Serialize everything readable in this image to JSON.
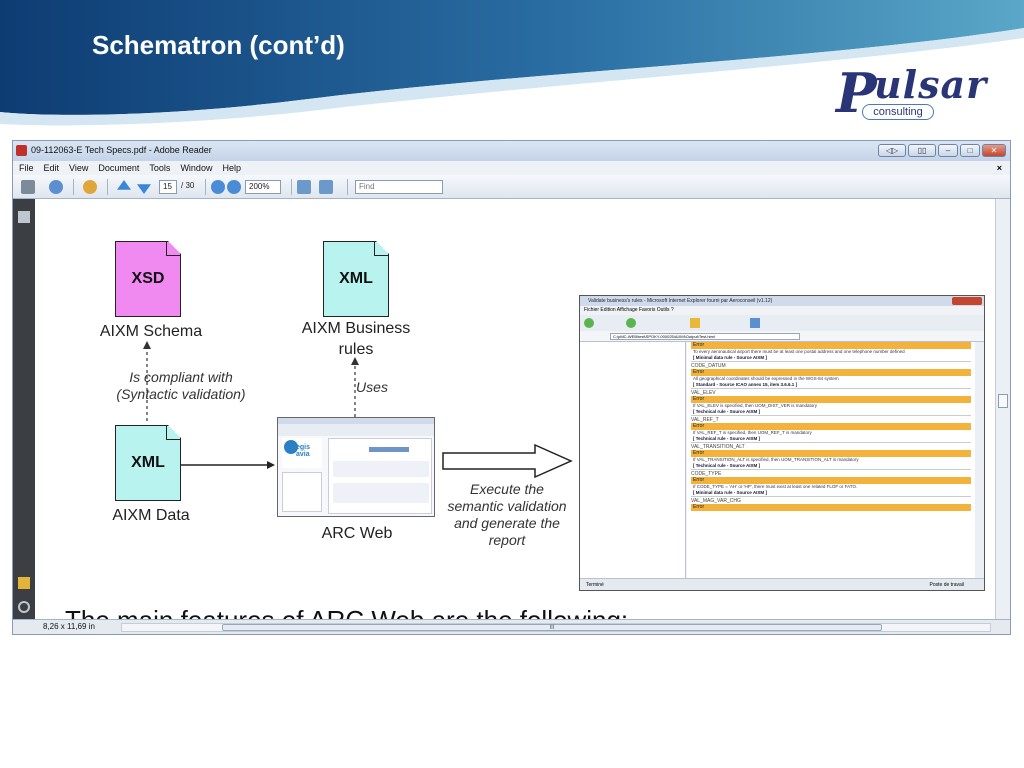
{
  "slide": {
    "title": "Schematron (cont’d)",
    "logo_text": "ulsar",
    "logo_initial": "P",
    "logo_sub": "consulting",
    "colors": {
      "header_dark": "#0d3c73",
      "header_light": "#5aa7c8",
      "logo": "#2a3578"
    }
  },
  "reader": {
    "window_title": "09-112063-E Tech Specs.pdf - Adobe Reader",
    "menu": [
      "File",
      "Edit",
      "View",
      "Document",
      "Tools",
      "Window",
      "Help"
    ],
    "menu_close": "×",
    "page_current": "15",
    "page_total": "/ 30",
    "zoom": "200%",
    "find_placeholder": "Find",
    "page_size": "8,26 x 11,69 in",
    "scroll_grip": "III",
    "bottom_cutoff_text": "The main features of ARC Web are the following:"
  },
  "diagram": {
    "xsd_label": "XSD",
    "xsd_caption": "AIXM Schema",
    "xml_rules_label": "XML",
    "xml_rules_caption_1": "AIXM Business",
    "xml_rules_caption_2": "rules",
    "xml_data_label": "XML",
    "xml_data_caption": "AIXM Data",
    "compliant_1": "Is compliant with",
    "compliant_2": "(Syntactic validation)",
    "uses": "Uses",
    "arc_web": "ARC Web",
    "execute_1": "Execute the",
    "execute_2": "semantic validation",
    "execute_3": "and generate the",
    "execute_4": "report",
    "mini_logo": "egis avia"
  },
  "report": {
    "title": "Validate business's rules - Microsoft Internet Explorer fourni par Aeroconseil (v1.12)",
    "menu": "Fichier  Edition  Affichage  Favoris  Outils  ?",
    "address": "C:\\pMC-WEB\\test\\SPOKY-000025\\AIXM\\Output\\Test.html",
    "status_left": "Terminé",
    "status_right": "Poste de travail",
    "rules": [
      {
        "name": "",
        "err": "Error",
        "lines": [
          "To every aeronautical airport there must be at least one postal address and one telephone number defined",
          "[ Minimal data rule - Source AIXM ]"
        ]
      },
      {
        "name": "CODE_DATUM",
        "err": "Error",
        "lines": [
          "All geographical coordinates should be expressed in the WGS-84 system",
          "[ Standard - Source ICAO annex 15, item 3.6.6.1 ]"
        ]
      },
      {
        "name": "VAL_ELEV",
        "err": "Error",
        "lines": [
          "If VAL_ELEV is specified, then UOM_DIST_VER is mandatory",
          "[ Technical rule - Source AIXM ]"
        ]
      },
      {
        "name": "VAL_REF_T",
        "err": "Error",
        "lines": [
          "If VAL_REF_T is specified, then UOM_REF_T is mandatory",
          "[ Technical rule - Source AIXM ]"
        ]
      },
      {
        "name": "VAL_TRANSITION_ALT",
        "err": "Error",
        "lines": [
          "If VAL_TRANSITION_ALT is specified, then UOM_TRANSITION_ALT is mandatory",
          "[ Technical rule - Source AIXM ]"
        ]
      },
      {
        "name": "CODE_TYPE",
        "err": "Error",
        "lines": [
          "If CODE_TYPE = 'AH' or 'HP', there must exist at least one related FLOF or FATO.",
          "[ Minimal data rule - Source AIXM ]"
        ]
      },
      {
        "name": "VAL_MAG_VAR_CHG",
        "err": "Error",
        "lines": []
      }
    ]
  }
}
